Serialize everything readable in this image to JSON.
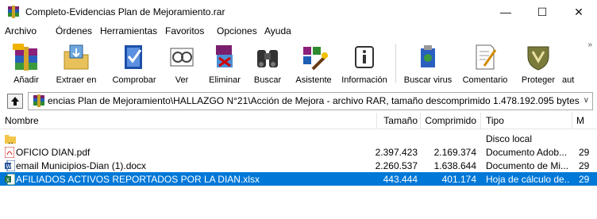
{
  "window": {
    "title": "Completo-Evidencias Plan de Mejoramiento.rar",
    "min_symbol": "—",
    "max_symbol": "☐",
    "close_symbol": "✕"
  },
  "menu": [
    "Archivo",
    "Órdenes",
    "Herramientas",
    "Favoritos",
    "Opciones",
    "Ayuda"
  ],
  "toolbar": [
    {
      "label": "Añadir",
      "icon": "add-archive-icon"
    },
    {
      "label": "Extraer en",
      "icon": "extract-icon"
    },
    {
      "label": "Comprobar",
      "icon": "test-icon"
    },
    {
      "label": "Ver",
      "icon": "view-icon"
    },
    {
      "label": "Eliminar",
      "icon": "delete-icon"
    },
    {
      "label": "Buscar",
      "icon": "find-binoculars-icon"
    },
    {
      "label": "Asistente",
      "icon": "wizard-icon"
    },
    {
      "label": "Información",
      "icon": "info-icon"
    },
    {
      "label": "Buscar virus",
      "icon": "virus-scan-icon"
    },
    {
      "label": "Comentario",
      "icon": "comment-icon"
    },
    {
      "label": "Proteger",
      "icon": "protect-shield-icon"
    },
    {
      "label": "aut",
      "icon": ""
    }
  ],
  "toolbar_more": "»",
  "address": {
    "text": "encias Plan de Mejoramiento\\HALLAZGO N°21\\Acción de Mejora - archivo RAR, tamaño descomprimido 1.478.192.095 bytes",
    "dropdown": "∨"
  },
  "columns": {
    "name": "Nombre",
    "size": "Tamaño",
    "packed": "Comprimido",
    "type": "Tipo",
    "modified": "M"
  },
  "rows": [
    {
      "name": "..",
      "size": "",
      "packed": "",
      "type": "Disco local",
      "modified": "",
      "icon": "folder-up-icon",
      "selected": false
    },
    {
      "name": "OFICIO DIAN.pdf",
      "size": "2.397.423",
      "packed": "2.169.374",
      "type": "Documento Adob...",
      "modified": "29",
      "icon": "pdf-icon",
      "selected": false
    },
    {
      "name": "email Municipios-Dian (1).docx",
      "size": "2.260.537",
      "packed": "1.638.644",
      "type": "Documento de Mi...",
      "modified": "29",
      "icon": "word-icon",
      "selected": false
    },
    {
      "name": "AFILIADOS ACTIVOS REPORTADOS POR LA DIAN.xlsx",
      "size": "443.444",
      "packed": "401.174",
      "type": "Hoja de cálculo de...",
      "modified": "29",
      "icon": "excel-icon",
      "selected": true
    }
  ]
}
